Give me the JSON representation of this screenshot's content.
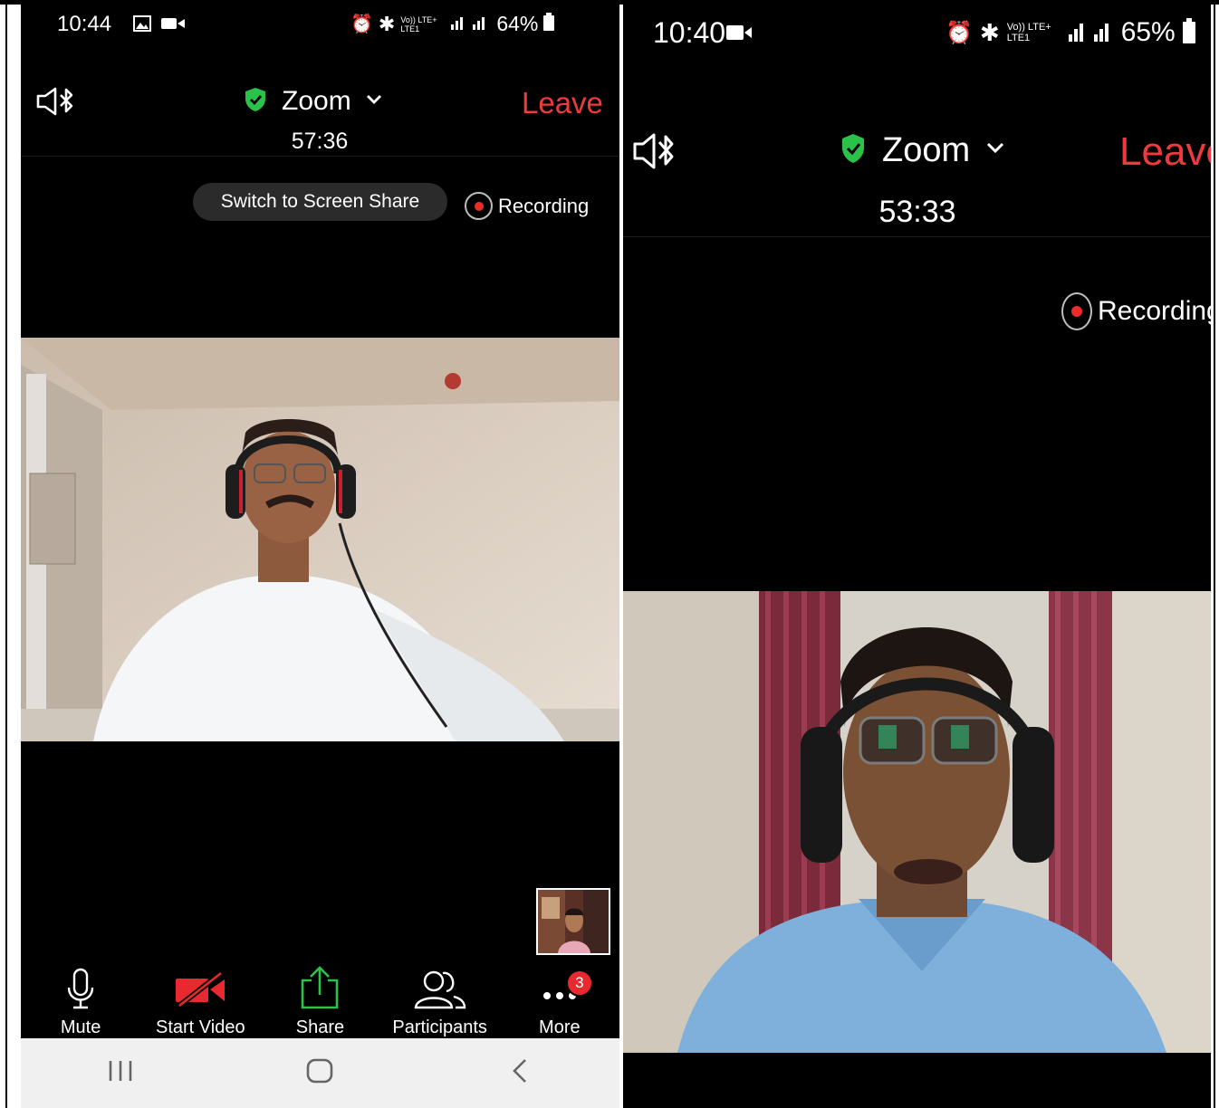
{
  "left": {
    "status": {
      "time": "10:44",
      "network": "Vo)) LTE+ LTE1",
      "battery": "64%"
    },
    "header": {
      "title": "Zoom",
      "leave": "Leave",
      "timer": "57:36"
    },
    "screen_share_label": "Switch to Screen Share",
    "recording_label": "Recording",
    "toolbar": [
      {
        "name": "mute-button",
        "icon": "microphone-icon",
        "label": "Mute"
      },
      {
        "name": "start-video-button",
        "icon": "video-off-icon",
        "label": "Start Video"
      },
      {
        "name": "share-button",
        "icon": "share-icon",
        "label": "Share"
      },
      {
        "name": "participants-button",
        "icon": "participants-icon",
        "label": "Participants"
      },
      {
        "name": "more-button",
        "icon": "more-icon",
        "label": "More",
        "badge": "3"
      }
    ],
    "nav": [
      "recents-icon",
      "home-icon",
      "back-icon"
    ]
  },
  "right": {
    "status": {
      "time": "10:40",
      "network": "Vo)) LTE+ LTE1",
      "battery": "65%"
    },
    "header": {
      "title": "Zoom",
      "leave": "Leave",
      "timer": "53:33"
    },
    "recording_label": "Recording"
  },
  "colors": {
    "leave": "#f0393c",
    "shield": "#2bc24a",
    "recording": "#ee2b2b",
    "video_off": "#e8292f",
    "share": "#2bc24a",
    "background": "#000000",
    "navbar": "#f0f0f0"
  }
}
